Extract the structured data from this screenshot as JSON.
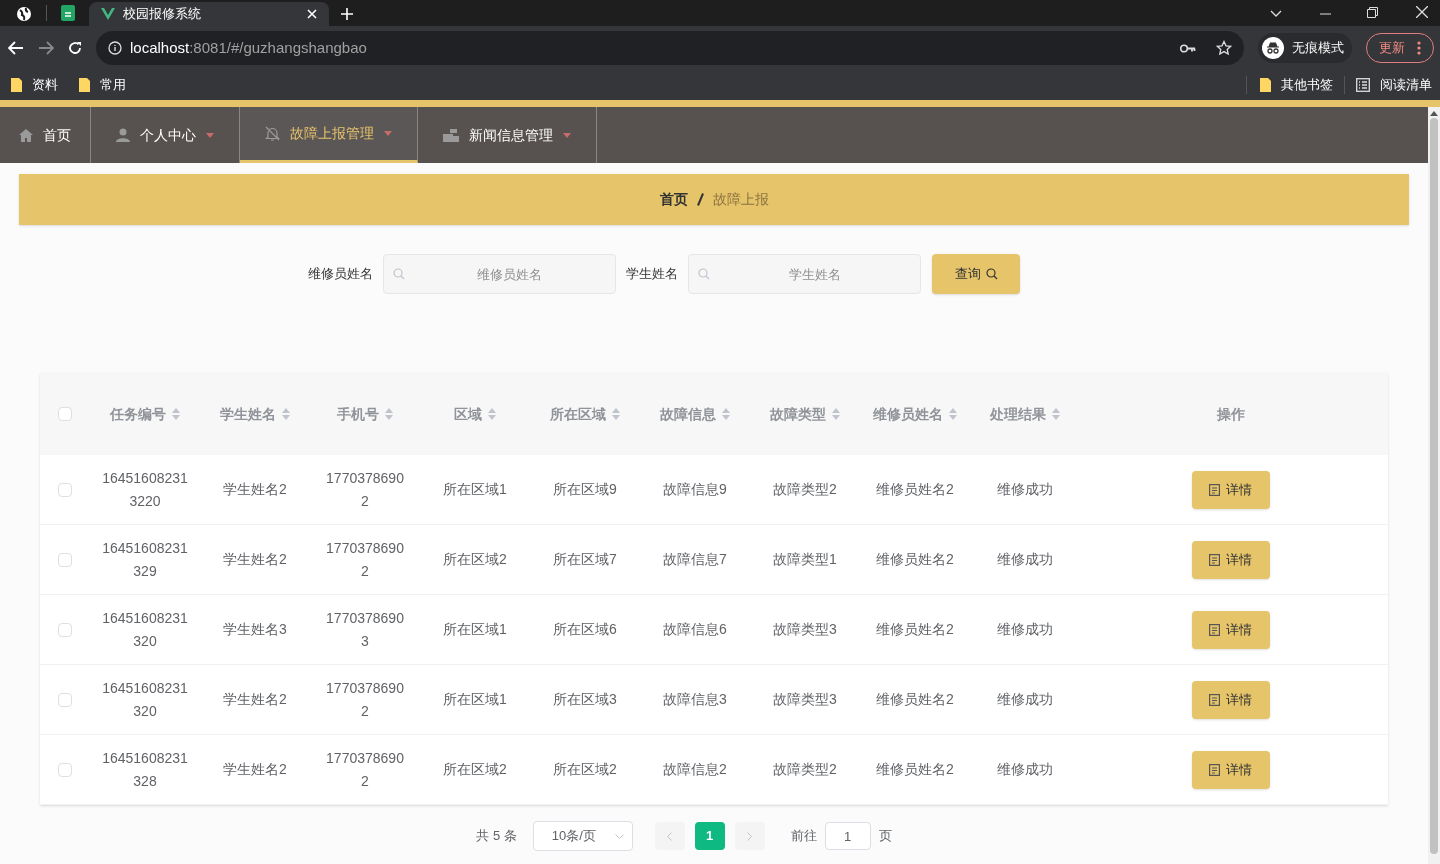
{
  "browser": {
    "tab": {
      "title": "校园报修系统"
    },
    "address": {
      "host": "localhost",
      "path": ":8081/#/guzhangshangbao"
    },
    "profile": "无痕模式",
    "update_button": "更新",
    "bookmarks": [
      {
        "kind": "folder",
        "label": "资料"
      },
      {
        "kind": "folder",
        "label": "常用"
      }
    ],
    "bookmarks_right": [
      {
        "kind": "folder",
        "label": "其他书签"
      },
      {
        "kind": "list",
        "label": "阅读清单"
      }
    ]
  },
  "nav": {
    "items": [
      {
        "label": "首页",
        "selected": false,
        "has_menu": false
      },
      {
        "label": "个人中心",
        "selected": false,
        "has_menu": true
      },
      {
        "label": "故障上报管理",
        "selected": true,
        "has_menu": true
      },
      {
        "label": "新闻信息管理",
        "selected": false,
        "has_menu": true
      }
    ]
  },
  "breadcrumb": [
    "首页",
    "故障上报"
  ],
  "search": {
    "fields": [
      {
        "label": "维修员姓名",
        "placeholder": "维修员姓名"
      },
      {
        "label": "学生姓名",
        "placeholder": "学生姓名"
      }
    ],
    "button": "查询"
  },
  "table": {
    "select_all": {
      "checked": false
    },
    "columns": [
      {
        "label": "任务编号",
        "sortable": true
      },
      {
        "label": "学生姓名",
        "sortable": true
      },
      {
        "label": "手机号",
        "sortable": true
      },
      {
        "label": "区域",
        "sortable": true
      },
      {
        "label": "所在区域",
        "sortable": true
      },
      {
        "label": "故障信息",
        "sortable": true
      },
      {
        "label": "故障类型",
        "sortable": true
      },
      {
        "label": "维修员姓名",
        "sortable": true
      },
      {
        "label": "处理结果",
        "sortable": true
      },
      {
        "label": "操作",
        "sortable": false
      }
    ],
    "rows": [
      {
        "checked": false,
        "cells": [
          "164516082313220",
          "学生姓名2",
          "17703786902",
          "所在区域1",
          "所在区域9",
          "故障信息9",
          "故障类型2",
          "维修员姓名2",
          "维修成功"
        ],
        "action": "详情"
      },
      {
        "checked": false,
        "cells": [
          "16451608231329",
          "学生姓名2",
          "17703786902",
          "所在区域2",
          "所在区域7",
          "故障信息7",
          "故障类型1",
          "维修员姓名2",
          "维修成功"
        ],
        "action": "详情"
      },
      {
        "checked": false,
        "cells": [
          "16451608231320",
          "学生姓名3",
          "17703786903",
          "所在区域1",
          "所在区域6",
          "故障信息6",
          "故障类型3",
          "维修员姓名2",
          "维修成功"
        ],
        "action": "详情"
      },
      {
        "checked": false,
        "cells": [
          "16451608231320",
          "学生姓名2",
          "17703786902",
          "所在区域1",
          "所在区域3",
          "故障信息3",
          "故障类型3",
          "维修员姓名2",
          "维修成功"
        ],
        "action": "详情"
      },
      {
        "checked": false,
        "cells": [
          "16451608231328",
          "学生姓名2",
          "17703786902",
          "所在区域2",
          "所在区域2",
          "故障信息2",
          "故障类型2",
          "维修员姓名2",
          "维修成功"
        ],
        "action": "详情"
      }
    ]
  },
  "pagination": {
    "total": "共 5 条",
    "page_size": "10条/页",
    "pages": [
      {
        "label": "1",
        "selected": true
      }
    ],
    "goto_label": "前往",
    "goto_value": "1",
    "page_suffix": "页"
  }
}
